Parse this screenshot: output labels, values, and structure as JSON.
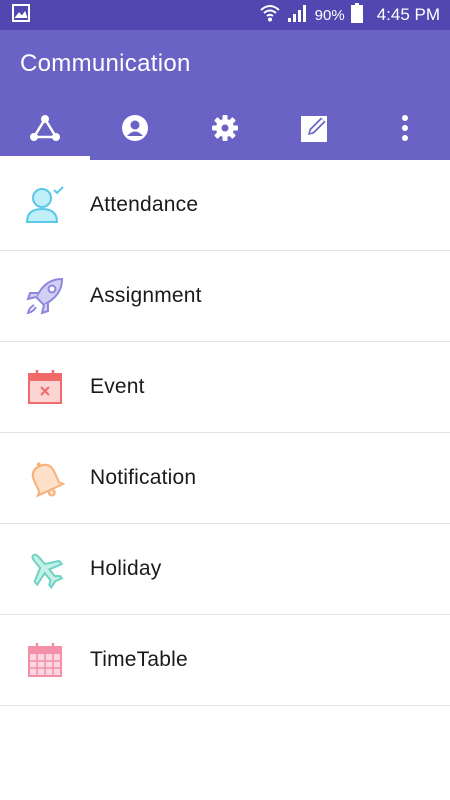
{
  "status_bar": {
    "battery": "90%",
    "time": "4:45 PM",
    "icons": [
      "gallery-icon",
      "wifi-icon",
      "signal-icon",
      "battery-icon"
    ]
  },
  "app_bar": {
    "title": "Communication",
    "colors": {
      "status": "#5048b0",
      "primary": "#6a63c6"
    },
    "tabs": [
      {
        "icon": "share-network-icon",
        "active": true
      },
      {
        "icon": "account-icon",
        "active": false
      },
      {
        "icon": "settings-gear-icon",
        "active": false
      },
      {
        "icon": "edit-compose-icon",
        "active": false
      },
      {
        "icon": "more-vert-icon",
        "active": false
      }
    ]
  },
  "list": {
    "items": [
      {
        "label": "Attendance",
        "icon": "attendance-person-check-icon",
        "color": "#5bc8e8"
      },
      {
        "label": "Assignment",
        "icon": "rocket-icon",
        "color": "#8e87e0"
      },
      {
        "label": "Event",
        "icon": "calendar-x-icon",
        "color": "#f26b6b"
      },
      {
        "label": "Notification",
        "icon": "bell-icon",
        "color": "#f7b27a"
      },
      {
        "label": "Holiday",
        "icon": "airplane-icon",
        "color": "#6fd3c3"
      },
      {
        "label": "TimeTable",
        "icon": "calendar-grid-icon",
        "color": "#f48fa8"
      }
    ]
  }
}
